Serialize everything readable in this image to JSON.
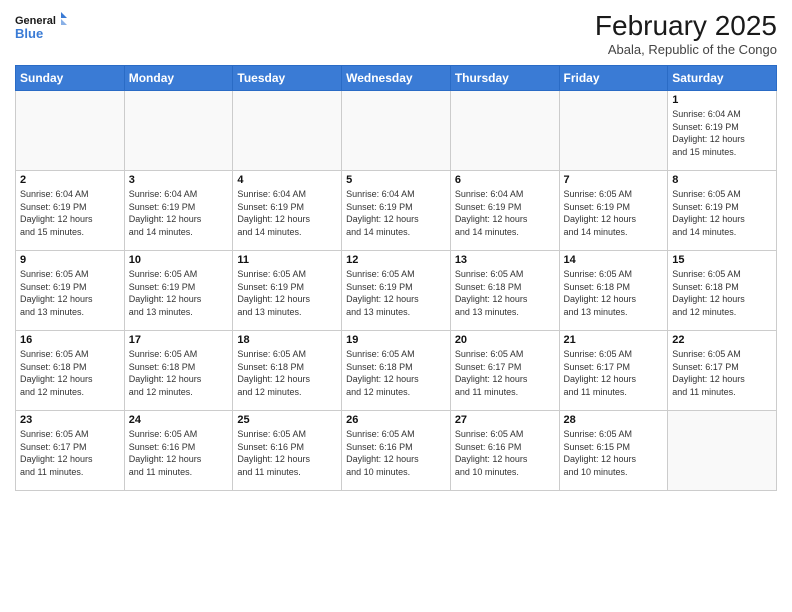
{
  "logo": {
    "general": "General",
    "blue": "Blue"
  },
  "header": {
    "month": "February 2025",
    "location": "Abala, Republic of the Congo"
  },
  "columns": [
    "Sunday",
    "Monday",
    "Tuesday",
    "Wednesday",
    "Thursday",
    "Friday",
    "Saturday"
  ],
  "weeks": [
    [
      {
        "day": "",
        "info": ""
      },
      {
        "day": "",
        "info": ""
      },
      {
        "day": "",
        "info": ""
      },
      {
        "day": "",
        "info": ""
      },
      {
        "day": "",
        "info": ""
      },
      {
        "day": "",
        "info": ""
      },
      {
        "day": "1",
        "info": "Sunrise: 6:04 AM\nSunset: 6:19 PM\nDaylight: 12 hours\nand 15 minutes."
      }
    ],
    [
      {
        "day": "2",
        "info": "Sunrise: 6:04 AM\nSunset: 6:19 PM\nDaylight: 12 hours\nand 15 minutes."
      },
      {
        "day": "3",
        "info": "Sunrise: 6:04 AM\nSunset: 6:19 PM\nDaylight: 12 hours\nand 14 minutes."
      },
      {
        "day": "4",
        "info": "Sunrise: 6:04 AM\nSunset: 6:19 PM\nDaylight: 12 hours\nand 14 minutes."
      },
      {
        "day": "5",
        "info": "Sunrise: 6:04 AM\nSunset: 6:19 PM\nDaylight: 12 hours\nand 14 minutes."
      },
      {
        "day": "6",
        "info": "Sunrise: 6:04 AM\nSunset: 6:19 PM\nDaylight: 12 hours\nand 14 minutes."
      },
      {
        "day": "7",
        "info": "Sunrise: 6:05 AM\nSunset: 6:19 PM\nDaylight: 12 hours\nand 14 minutes."
      },
      {
        "day": "8",
        "info": "Sunrise: 6:05 AM\nSunset: 6:19 PM\nDaylight: 12 hours\nand 14 minutes."
      }
    ],
    [
      {
        "day": "9",
        "info": "Sunrise: 6:05 AM\nSunset: 6:19 PM\nDaylight: 12 hours\nand 13 minutes."
      },
      {
        "day": "10",
        "info": "Sunrise: 6:05 AM\nSunset: 6:19 PM\nDaylight: 12 hours\nand 13 minutes."
      },
      {
        "day": "11",
        "info": "Sunrise: 6:05 AM\nSunset: 6:19 PM\nDaylight: 12 hours\nand 13 minutes."
      },
      {
        "day": "12",
        "info": "Sunrise: 6:05 AM\nSunset: 6:19 PM\nDaylight: 12 hours\nand 13 minutes."
      },
      {
        "day": "13",
        "info": "Sunrise: 6:05 AM\nSunset: 6:18 PM\nDaylight: 12 hours\nand 13 minutes."
      },
      {
        "day": "14",
        "info": "Sunrise: 6:05 AM\nSunset: 6:18 PM\nDaylight: 12 hours\nand 13 minutes."
      },
      {
        "day": "15",
        "info": "Sunrise: 6:05 AM\nSunset: 6:18 PM\nDaylight: 12 hours\nand 12 minutes."
      }
    ],
    [
      {
        "day": "16",
        "info": "Sunrise: 6:05 AM\nSunset: 6:18 PM\nDaylight: 12 hours\nand 12 minutes."
      },
      {
        "day": "17",
        "info": "Sunrise: 6:05 AM\nSunset: 6:18 PM\nDaylight: 12 hours\nand 12 minutes."
      },
      {
        "day": "18",
        "info": "Sunrise: 6:05 AM\nSunset: 6:18 PM\nDaylight: 12 hours\nand 12 minutes."
      },
      {
        "day": "19",
        "info": "Sunrise: 6:05 AM\nSunset: 6:18 PM\nDaylight: 12 hours\nand 12 minutes."
      },
      {
        "day": "20",
        "info": "Sunrise: 6:05 AM\nSunset: 6:17 PM\nDaylight: 12 hours\nand 11 minutes."
      },
      {
        "day": "21",
        "info": "Sunrise: 6:05 AM\nSunset: 6:17 PM\nDaylight: 12 hours\nand 11 minutes."
      },
      {
        "day": "22",
        "info": "Sunrise: 6:05 AM\nSunset: 6:17 PM\nDaylight: 12 hours\nand 11 minutes."
      }
    ],
    [
      {
        "day": "23",
        "info": "Sunrise: 6:05 AM\nSunset: 6:17 PM\nDaylight: 12 hours\nand 11 minutes."
      },
      {
        "day": "24",
        "info": "Sunrise: 6:05 AM\nSunset: 6:16 PM\nDaylight: 12 hours\nand 11 minutes."
      },
      {
        "day": "25",
        "info": "Sunrise: 6:05 AM\nSunset: 6:16 PM\nDaylight: 12 hours\nand 11 minutes."
      },
      {
        "day": "26",
        "info": "Sunrise: 6:05 AM\nSunset: 6:16 PM\nDaylight: 12 hours\nand 10 minutes."
      },
      {
        "day": "27",
        "info": "Sunrise: 6:05 AM\nSunset: 6:16 PM\nDaylight: 12 hours\nand 10 minutes."
      },
      {
        "day": "28",
        "info": "Sunrise: 6:05 AM\nSunset: 6:15 PM\nDaylight: 12 hours\nand 10 minutes."
      },
      {
        "day": "",
        "info": ""
      }
    ]
  ]
}
